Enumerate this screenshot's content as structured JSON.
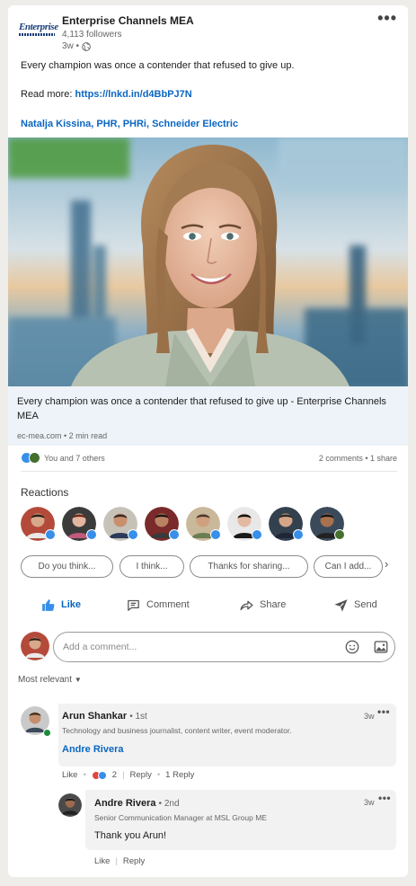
{
  "post": {
    "org_name": "Enterprise Channels MEA",
    "followers": "4,113 followers",
    "time": "3w •",
    "logo_text": "Enterprise",
    "text": "Every champion was once a contender that refused to give up.",
    "read_more_label": "Read more: ",
    "read_more_link": "https://lnkd.in/d4BbPJ7N",
    "mention": "Natalja Kissina, PHR, PHRi, Schneider Electric",
    "link_title": "Every champion was once a contender that refused to give up - Enterprise Channels MEA",
    "link_source": "ec-mea.com • 2 min read"
  },
  "social": {
    "reactors": "You and 7 others",
    "counts": "2 comments • 1 share"
  },
  "reactions": {
    "label": "Reactions",
    "avatars": [
      {
        "skin": "#d7a88a",
        "hair": "#2a1f18",
        "shirt": "#e9e9e9",
        "bg": "#b44a3a",
        "badge": "like"
      },
      {
        "skin": "#e4b5a0",
        "hair": "#6b2a1a",
        "shirt": "#c05a7a",
        "bg": "#3b3b3b",
        "badge": "like"
      },
      {
        "skin": "#c98f6d",
        "hair": "#3a2c22",
        "shirt": "#2d3a58",
        "bg": "#c7c2b8",
        "badge": "like"
      },
      {
        "skin": "#b98363",
        "hair": "#1c1612",
        "shirt": "#3a3a3a",
        "bg": "#7a2a2a",
        "badge": "like"
      },
      {
        "skin": "#d1a07f",
        "hair": "#4a3a30",
        "shirt": "#6b7d55",
        "bg": "#c9b89a",
        "badge": "like"
      },
      {
        "skin": "#e2b9a2",
        "hair": "#111111",
        "shirt": "#1a1a1a",
        "bg": "#e8e8e8",
        "badge": "like"
      },
      {
        "skin": "#d6a587",
        "hair": "#2a2a2a",
        "shirt": "#1f2636",
        "bg": "#33414f",
        "badge": "like"
      },
      {
        "skin": "#a8724f",
        "hair": "#141414",
        "shirt": "#222222",
        "bg": "#3b4a5a",
        "badge": "celebrate"
      }
    ]
  },
  "chips": [
    "Do you think...",
    "I think...",
    "Thanks for sharing...",
    "Can I add..."
  ],
  "actions": {
    "like": "Like",
    "comment": "Comment",
    "share": "Share",
    "send": "Send"
  },
  "comment_input": {
    "placeholder": "Add a comment..."
  },
  "sort_label": "Most relevant",
  "comments": [
    {
      "name": "Arun Shankar",
      "degree": "• 1st",
      "headline": "Technology and business journalist, content writer, event moderator.",
      "text": "Andre Rivera",
      "time": "3w",
      "like": "Like",
      "reaction_count": "2",
      "reply": "Reply",
      "replies": "1 Reply"
    },
    {
      "name": "Andre Rivera",
      "degree": "• 2nd",
      "headline": "Senior Communication Manager at MSL Group ME",
      "text": "Thank you Arun!",
      "time": "3w",
      "like": "Like",
      "reply": "Reply"
    }
  ],
  "colors": {
    "brand_blue": "#0a66c2",
    "like_blue": "#378fe9",
    "celebrate_green": "#44712e"
  }
}
